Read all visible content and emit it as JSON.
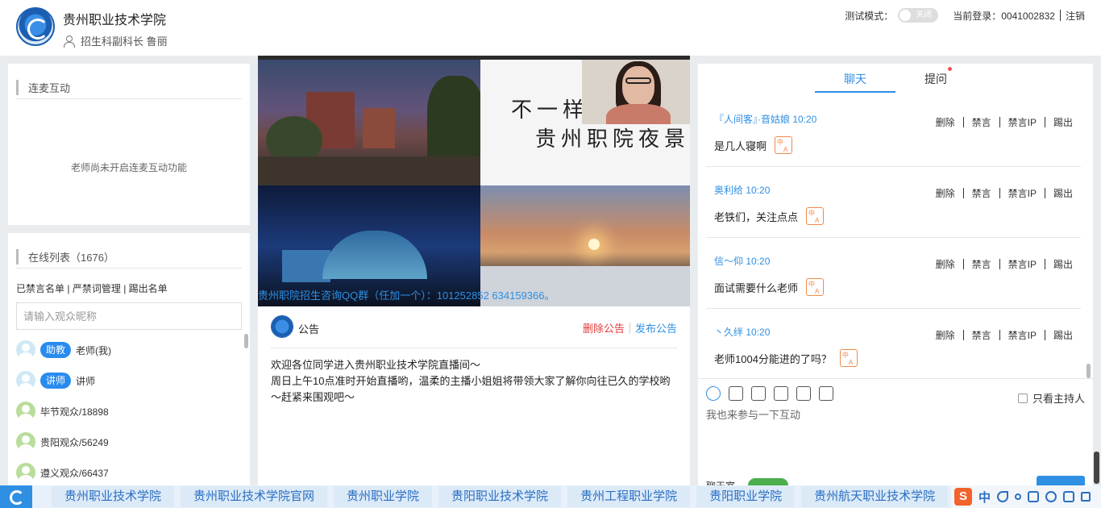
{
  "header": {
    "school_name": "贵州职业技术学院",
    "user_label": "招生科副科长 鲁丽",
    "test_mode_label": "测试模式：",
    "test_mode_state": "关闭",
    "current_login": "当前登录：0041002832",
    "logout": "注销"
  },
  "mic_panel": {
    "title": "连麦互动",
    "empty_text": "老师尚未开启连麦互动功能"
  },
  "online_panel": {
    "title": "在线列表（1676）",
    "link_muted": "已禁言名单",
    "link_words": "严禁词管理",
    "link_kicked": "踢出名单",
    "link_sep": "|",
    "search_placeholder": "请输入观众昵称",
    "users": [
      {
        "role": "助教",
        "name": "老师(我)"
      },
      {
        "role": "讲师",
        "name": "讲师"
      },
      {
        "role": "",
        "name": "毕节观众/18898"
      },
      {
        "role": "",
        "name": "贵阳观众/56249"
      },
      {
        "role": "",
        "name": "遵义观众/66437"
      }
    ]
  },
  "video": {
    "title_line1": "不一样的",
    "title_line2": "贵州职院夜景",
    "marquee": "贵州职院招生咨询QQ群（任加一个）：101252852   634159366。"
  },
  "notice": {
    "title": "公告",
    "delete": "删除公告",
    "publish": "发布公告",
    "line1": "欢迎各位同学进入贵州职业技术学院直播间～",
    "line2": "周日上午10点准时开始直播哟，温柔的主播小姐姐将带领大家了解你向往已久的学校哟～赶紧来围观吧～"
  },
  "chat": {
    "tab_chat": "聊天",
    "tab_question": "提问",
    "ops": {
      "delete": "删除",
      "mute": "禁言",
      "mute_ip": "禁言IP",
      "kick": "踢出"
    },
    "messages": [
      {
        "name": "『人间客』·音姑娘  10:20",
        "text": "是几人寝啊"
      },
      {
        "name": "奥利给  10:20",
        "text": "老铁们，关注点点"
      },
      {
        "name": "信～仰  10:20",
        "text": "面试需要什么老师"
      },
      {
        "name": "丶久绊  10:20",
        "text": "老师1004分能进的了吗？"
      }
    ],
    "only_host": "只看主持人",
    "input_placeholder": "我也来参与一下互动",
    "partial_label": "聊天室"
  },
  "bottombar": {
    "items": [
      "贵州职业技术学院",
      "贵州职业技术学院官网",
      "贵州职业学院",
      "贵阳职业技术学院",
      "贵州工程职业学院",
      "贵阳职业学院",
      "贵州航天职业技术学院"
    ],
    "ime_s": "S",
    "ime_zh": "中"
  }
}
